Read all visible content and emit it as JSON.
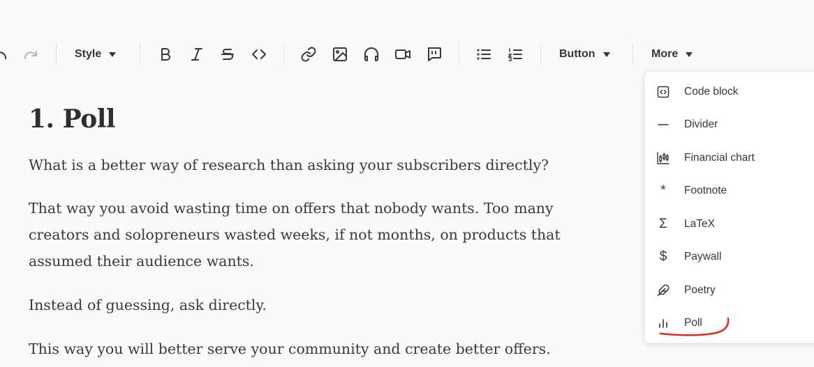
{
  "toolbar": {
    "style_label": "Style",
    "button_label": "Button",
    "more_label": "More"
  },
  "icons": [
    "undo-icon",
    "redo-icon",
    "bold-icon",
    "italic-icon",
    "strikethrough-icon",
    "code-icon",
    "link-icon",
    "image-icon",
    "audio-icon",
    "video-icon",
    "quote-icon",
    "bullet-list-icon",
    "numbered-list-icon"
  ],
  "editor": {
    "heading": "1. Poll",
    "paragraphs": [
      "What is a better way of research than asking your subscribers directly?",
      "That way you avoid wasting time on offers that nobody wants. Too many",
      "creators and solopreneurs wasted weeks, if not months, on products that",
      "assumed their audience wants.",
      "Instead of guessing, ask directly.",
      "This way you will better serve your community and create better offers."
    ]
  },
  "more_menu": {
    "items": [
      {
        "label": "Code block",
        "icon": "code-block-icon"
      },
      {
        "label": "Divider",
        "icon": "divider-icon"
      },
      {
        "label": "Financial chart",
        "icon": "financial-chart-icon"
      },
      {
        "label": "Footnote",
        "icon": "footnote-icon"
      },
      {
        "label": "LaTeX",
        "icon": "latex-icon"
      },
      {
        "label": "Paywall",
        "icon": "paywall-icon"
      },
      {
        "label": "Poetry",
        "icon": "poetry-icon"
      },
      {
        "label": "Poll",
        "icon": "poll-icon"
      }
    ],
    "glyphs": {
      "footnote": "*",
      "latex": "Σ",
      "paywall": "$"
    }
  },
  "colors": {
    "annotation_underline": "#d93025",
    "text": "#363737"
  }
}
